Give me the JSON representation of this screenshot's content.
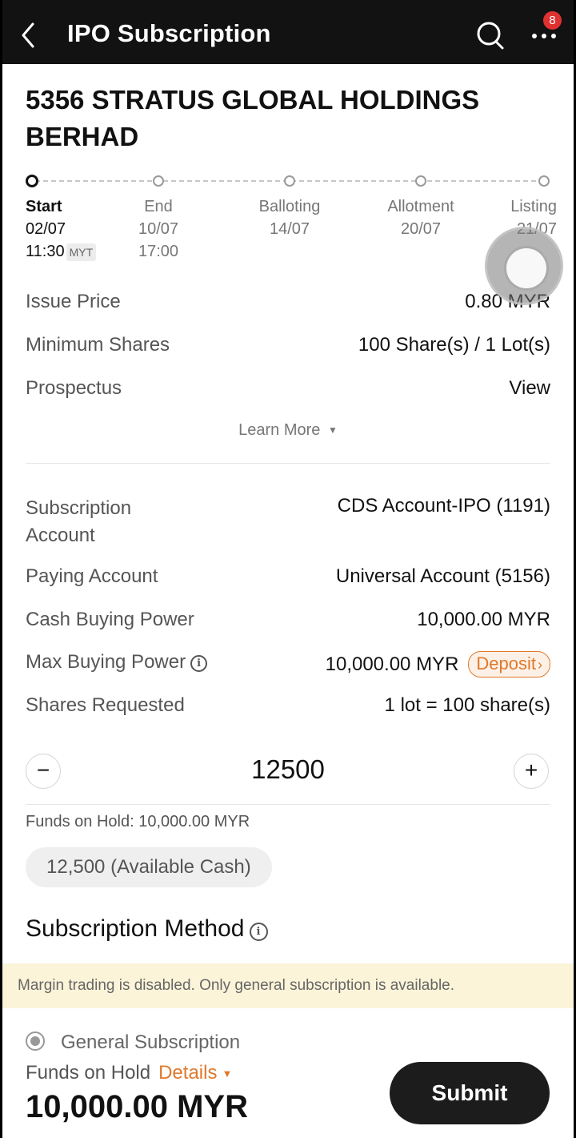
{
  "header": {
    "title": "IPO Subscription",
    "badge_count": "8"
  },
  "company": {
    "name": "5356 STRATUS GLOBAL HOLDINGS BERHAD"
  },
  "timeline": {
    "steps": [
      {
        "name": "Start",
        "date": "02/07",
        "time": "11:30",
        "tz": "MYT"
      },
      {
        "name": "End",
        "date": "10/07",
        "time": "17:00"
      },
      {
        "name": "Balloting",
        "date": "14/07"
      },
      {
        "name": "Allotment",
        "date": "20/07"
      },
      {
        "name": "Listing",
        "date": "21/07"
      }
    ]
  },
  "info": {
    "issue_price_label": "Issue Price",
    "issue_price_value": "0.80 MYR",
    "min_shares_label": "Minimum Shares",
    "min_shares_value": "100 Share(s) / 1 Lot(s)",
    "prospectus_label": "Prospectus",
    "prospectus_link": "View",
    "learn_more": "Learn More"
  },
  "account": {
    "subscription_account_label": "Subscription Account",
    "subscription_account_value": "CDS Account-IPO (1191)",
    "paying_account_label": "Paying Account",
    "paying_account_value": "Universal Account (5156)",
    "cash_bp_label": "Cash Buying Power",
    "cash_bp_value": "10,000.00 MYR",
    "max_bp_label": "Max Buying Power",
    "max_bp_value": "10,000.00 MYR",
    "deposit_label": "Deposit",
    "shares_requested_label": "Shares Requested",
    "shares_requested_hint": "1 lot = 100 share(s)"
  },
  "quantity": {
    "value": "12500",
    "minus": "−",
    "plus": "+"
  },
  "funds_on_hold_line": "Funds on Hold: 10,000.00 MYR",
  "available_chip": "12,500 (Available Cash)",
  "subscription_method": {
    "title": "Subscription Method",
    "notice": "Margin trading is disabled. Only general subscription is available.",
    "option": "General Subscription"
  },
  "footer": {
    "funds_label": "Funds on Hold",
    "details_label": "Details",
    "amount": "10,000.00 MYR",
    "submit_label": "Submit"
  },
  "colors": {
    "accent": "#e0792c",
    "link": "#2f67c6",
    "topbar": "#121212",
    "notice_bg": "#fcf4d9"
  }
}
